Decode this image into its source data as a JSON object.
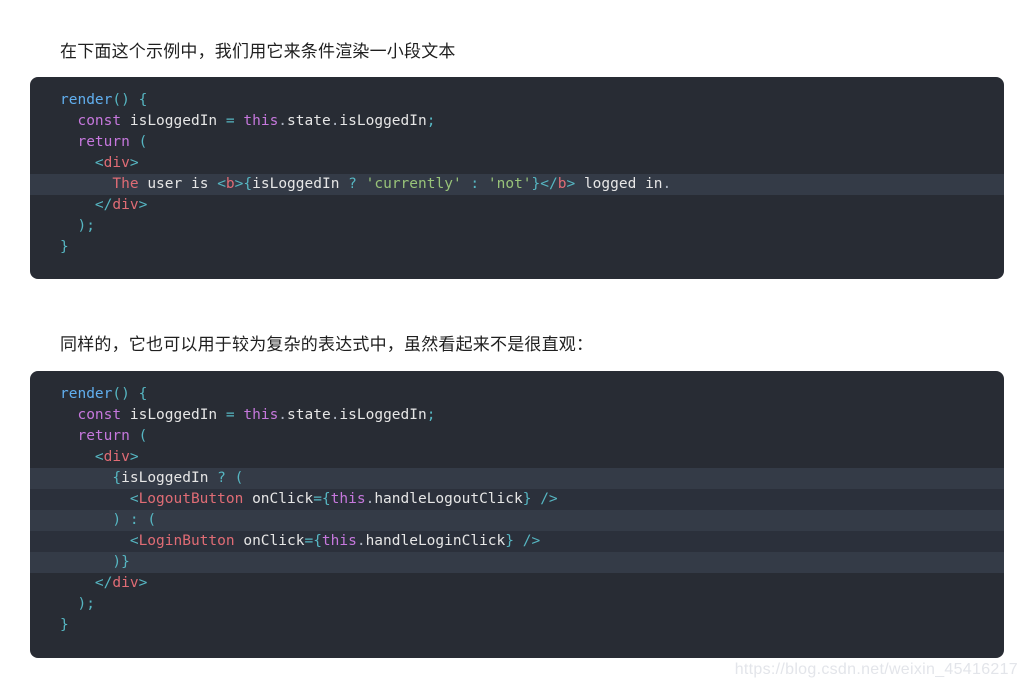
{
  "page": {
    "background_color": "#ffffff",
    "watermark": "https://blog.csdn.net/weixin_45416217"
  },
  "paragraphs": [
    {
      "id": "para-1",
      "text": "在下面这个示例中，我们用它来条件渲染一小段文本"
    },
    {
      "id": "para-2",
      "text": "同样的，它也可以用于较为复杂的表达式中，虽然看起来不是很直观："
    }
  ],
  "theme": {
    "code_background": "#282c34",
    "highlight_light": "#343b47",
    "highlight_dark": "#2b303b",
    "function_color": "#61afef",
    "punctuation_color": "#56b6c2",
    "keyword_color": "#c678dd",
    "tag_color": "#e06c75",
    "string_color": "#98c379",
    "text_color": "#abb2bf",
    "variable_color": "#e6e6e6"
  },
  "code_blocks": [
    {
      "id": "codeblock-1",
      "language": "jsx",
      "lines": [
        {
          "highlight": "none",
          "text": "render() {"
        },
        {
          "highlight": "none",
          "text": "  const isLoggedIn = this.state.isLoggedIn;"
        },
        {
          "highlight": "none",
          "text": "  return ("
        },
        {
          "highlight": "none",
          "text": "    <div>"
        },
        {
          "highlight": "light",
          "text": "      The user is <b>{isLoggedIn ? 'currently' : 'not'}</b> logged in."
        },
        {
          "highlight": "none",
          "text": "    </div>"
        },
        {
          "highlight": "none",
          "text": "  );"
        },
        {
          "highlight": "none",
          "text": "}"
        }
      ]
    },
    {
      "id": "codeblock-2",
      "language": "jsx",
      "lines": [
        {
          "highlight": "none",
          "text": "render() {"
        },
        {
          "highlight": "none",
          "text": "  const isLoggedIn = this.state.isLoggedIn;"
        },
        {
          "highlight": "none",
          "text": "  return ("
        },
        {
          "highlight": "none",
          "text": "    <div>"
        },
        {
          "highlight": "light",
          "text": "      {isLoggedIn ? ("
        },
        {
          "highlight": "dark",
          "text": "        <LogoutButton onClick={this.handleLogoutClick} />"
        },
        {
          "highlight": "light",
          "text": "      ) : ("
        },
        {
          "highlight": "dark",
          "text": "        <LoginButton onClick={this.handleLoginClick} />"
        },
        {
          "highlight": "light",
          "text": "      )}"
        },
        {
          "highlight": "none",
          "text": "    </div>"
        },
        {
          "highlight": "none",
          "text": "  );"
        },
        {
          "highlight": "none",
          "text": "}"
        }
      ]
    }
  ]
}
